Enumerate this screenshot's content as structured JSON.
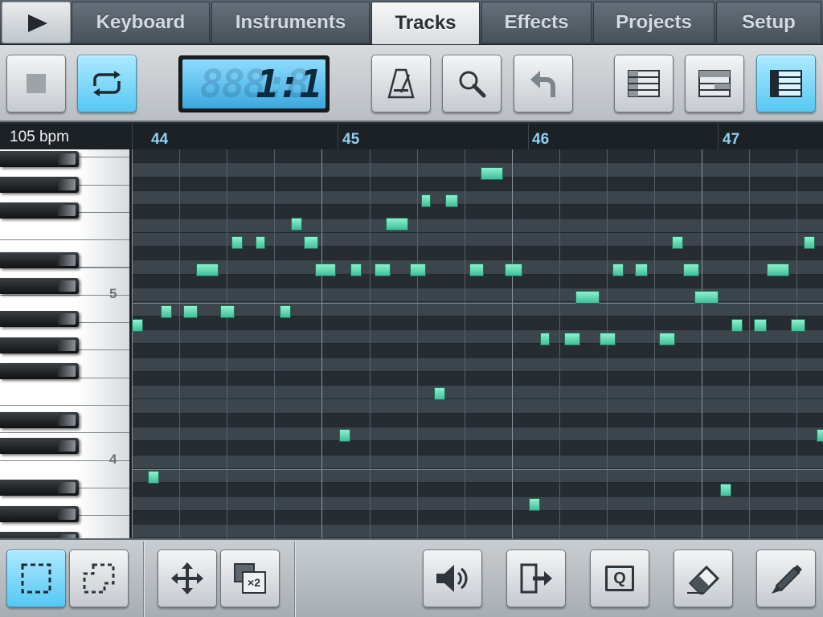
{
  "tabs": {
    "play_label": "",
    "items": [
      {
        "label": "Keyboard"
      },
      {
        "label": "Instruments"
      },
      {
        "label": "Tracks",
        "active": true
      },
      {
        "label": "Effects"
      },
      {
        "label": "Projects"
      },
      {
        "label": "Setup"
      }
    ]
  },
  "toolbar": {
    "stop": "stop-icon",
    "loop": "loop-icon",
    "loop_active": true,
    "position_display": "1:1",
    "position_ghost": "888:8",
    "metronome": "metronome-icon",
    "zoom": "magnifier-icon",
    "undo": "undo-arrow-icon",
    "view_list": "list-view-icon",
    "view_split": "split-view-icon",
    "view_piano_roll": "piano-roll-view-icon",
    "view_piano_roll_active": true
  },
  "piano_roll": {
    "tempo": "105 bpm",
    "bars": [
      "44",
      "45",
      "46",
      "47"
    ],
    "octave_labels": [
      "5",
      "4"
    ],
    "note_color": "#5fe0b4",
    "accent_color": "#8fd2f4"
  },
  "bottom_toolbar": {
    "select_rect": "select-rectangle-icon",
    "select_rect_active": true,
    "select_lasso": "select-lasso-icon",
    "move": "move-arrows-icon",
    "duplicate": "duplicate-x2-icon",
    "duplicate_label": "×2",
    "volume": "speaker-icon",
    "export": "export-arrow-icon",
    "quantize": "quantize-icon",
    "quantize_label": "Q",
    "eraser": "eraser-icon",
    "pencil": "pencil-icon"
  }
}
